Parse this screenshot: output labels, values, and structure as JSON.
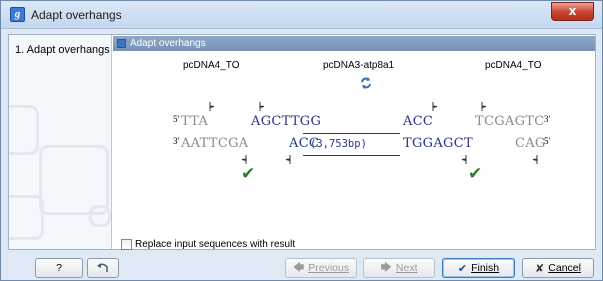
{
  "window": {
    "title": "Adapt overhangs",
    "app_icon_letter": "g",
    "close_glyph": "x"
  },
  "steps": {
    "items": [
      {
        "label": "1.  Adapt overhangs"
      }
    ]
  },
  "section": {
    "header": "Adapt overhangs"
  },
  "sequences": {
    "left_name": "pcDNA4_TO",
    "middle_name": "pcDNA3-atp8a1",
    "right_name": "pcDNA4_TO",
    "prime5": "5'",
    "prime3": "3'",
    "left_top": "TTA",
    "left_bottom": "AATTCGA",
    "mid_top_left": "AGCTTGG",
    "mid_top_right": "ACC",
    "mid_bottom_left": "ACC",
    "mid_bottom_right": "TGGAGCT",
    "length_label": "(3,753bp)",
    "right_top": "TCGAGTC",
    "right_bottom": "CAG",
    "swap_icon": "swap-icon"
  },
  "options": {
    "replace_label": "Replace input sequences with result",
    "replace_checked": false
  },
  "footer": {
    "help_label": "?",
    "previous_label": "Previous",
    "next_label": "Next",
    "finish_label": "Finish",
    "cancel_label": "Cancel"
  },
  "colors": {
    "accent": "#7693b6",
    "sequence_blue": "#27338f",
    "sequence_gray": "#8a8a8a",
    "check_green": "#2f7d2a",
    "close_red": "#c9442f"
  }
}
